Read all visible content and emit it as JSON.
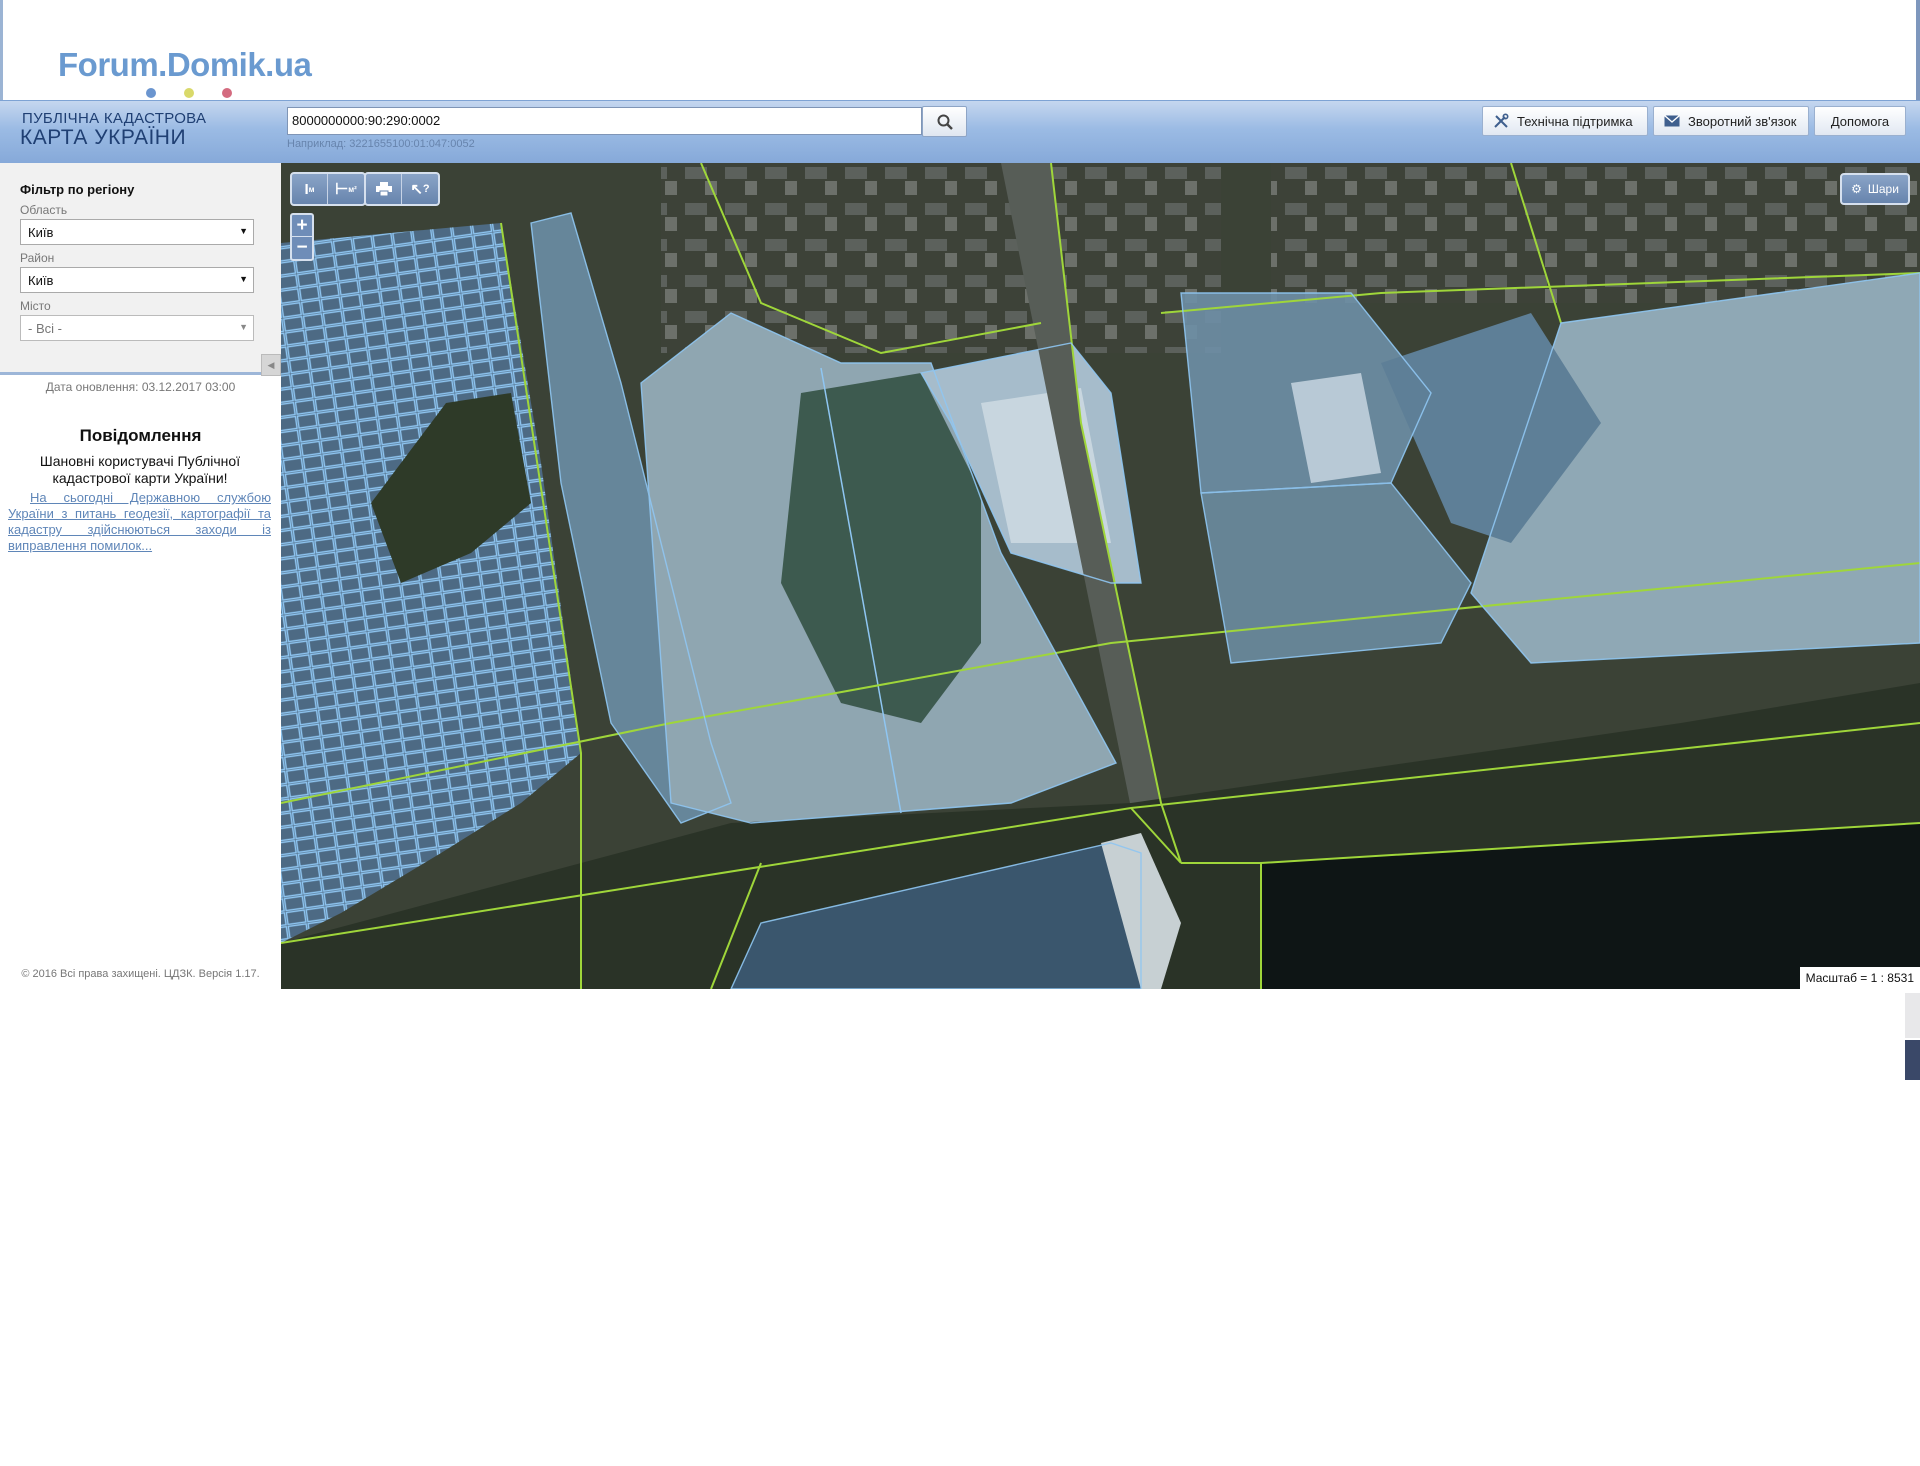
{
  "watermark": {
    "text": "Forum.Domik.ua",
    "dot_colors": [
      "#6b95cf",
      "#d9d96a",
      "#d46b7f"
    ]
  },
  "header": {
    "brand_line1": "ПУБЛІЧНА КАДАСТРОВА",
    "brand_line2": "КАРТА УКРАЇНИ",
    "search": {
      "value": "8000000000:90:290:0002",
      "hint": "Наприклад: 3221655100:01:047:0052",
      "button_icon": "search-icon"
    },
    "buttons": [
      {
        "label": "Технічна підтримка",
        "icon": "tools-icon"
      },
      {
        "label": "Зворотний зв'язок",
        "icon": "envelope-icon"
      },
      {
        "label": "Допомога"
      }
    ]
  },
  "sidebar": {
    "filter_title": "Фільтр по регіону",
    "oblast": {
      "label": "Область",
      "value": "Київ"
    },
    "raion": {
      "label": "Район",
      "value": "Київ"
    },
    "misto": {
      "label": "Місто",
      "value": "- Всі -"
    },
    "update_date": "Дата оновлення: 03.12.2017 03:00",
    "notice_title": "Повідомлення",
    "notice_greeting": "Шановні користувачі Публічної кадастрової карти України!",
    "notice_link": "На сьогодні Державною службою України з питань геодезії, картографії та кадастру здійснюються заходи із виправлення помилок...",
    "copyright": "© 2016 Всі права захищені. ЦДЗК. Версія 1.17."
  },
  "map": {
    "tools": [
      "ruler-icon",
      "area-measure-icon",
      "print-icon",
      "identify-icon"
    ],
    "tool_labels": [
      "м",
      "м²",
      "?"
    ],
    "zoom_in": "+",
    "zoom_out": "−",
    "layers_label": "Шари",
    "scale_text": "Масштаб = 1 : 8531"
  }
}
